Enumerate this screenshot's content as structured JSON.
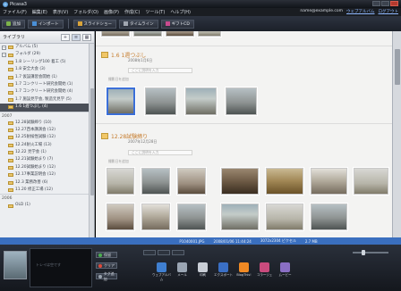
{
  "window": {
    "title": "Picasa3"
  },
  "menu": {
    "items": [
      "ファイル(F)",
      "編集(E)",
      "表示(V)",
      "フォルダ(O)",
      "画像(P)",
      "作成(C)",
      "ツール(T)",
      "ヘルプ(H)"
    ],
    "account": "name@example.com",
    "links": [
      "ウェブアルバム",
      "ログアウト"
    ]
  },
  "toolbar": {
    "add": "追加",
    "import": "インポート",
    "slideshow": "スライドショー",
    "timeline": "タイムライン",
    "gift": "ギフトCD"
  },
  "library": {
    "label": "ライブラリ",
    "toggle_collapsed": "−",
    "view_icons": [
      "+",
      "≡",
      "▦"
    ]
  },
  "folders": {
    "top": [
      {
        "label": "アルバム (5)"
      },
      {
        "label": "フォルダ (29)"
      }
    ],
    "items": [
      {
        "label": "1.8 シーリング100 着工 (5)"
      },
      {
        "label": "1.8 安全大会 (3)"
      },
      {
        "label": "1.7 仮設講習会開始 (1)"
      },
      {
        "label": "1.7 コンクリート研究会開始 (1)"
      },
      {
        "label": "1.7 コンクリート研究会開始 (4)"
      },
      {
        "label": "1.7 施設見学会, 製造元見学 (5)"
      },
      {
        "label": "1.6 1週つぶし (4)"
      }
    ],
    "group_2007": "2007",
    "items_2007": [
      {
        "label": "12.28試験締り (10)"
      },
      {
        "label": "12.27西本講演会 (12)"
      },
      {
        "label": "12.25耐候性試験 (12)"
      },
      {
        "label": "12.24耐火工場 (13)"
      },
      {
        "label": "12.22 見学会 (1)"
      },
      {
        "label": "12.21試験始まり (7)"
      },
      {
        "label": "12.20試験始まり (12)"
      },
      {
        "label": "12.17事業説明会 (12)"
      },
      {
        "label": "12.3 業務改善 (6)"
      },
      {
        "label": "11.20 修正工場 (12)"
      }
    ],
    "group_2006": "2006",
    "items_2006": [
      {
        "label": "OLD (1)"
      }
    ]
  },
  "main": {
    "folder1": {
      "name": "1.6 1週つぶし",
      "date": "2008年1月6日",
      "desc_placeholder": "ここに説明を入力",
      "hint": "撮影日を追加"
    },
    "folder2": {
      "name": "12.28試験締り",
      "date": "2007年12月28日",
      "desc_placeholder": "ここに説明を入力",
      "hint": "撮影日を追加"
    }
  },
  "status": {
    "items": [
      "P1040001.JPG",
      "2008/01/06 11:44:24",
      "3072x2304 ピクセル",
      "2.7 MB"
    ]
  },
  "tray": {
    "preview_note": "トレイは空です",
    "hold": "保留",
    "clear": "クリア",
    "add_tag": "タグ追加",
    "shares": [
      {
        "label": "ウェブアルバム",
        "color": "#3f7fd0"
      },
      {
        "label": "メール",
        "color": "#9aa5b3"
      },
      {
        "label": "印刷",
        "color": "#c9ced6"
      },
      {
        "label": "エクスポート",
        "color": "#3a6fc4"
      },
      {
        "label": "BlogThis!",
        "color": "#f08a24"
      },
      {
        "label": "コラージュ",
        "color": "#c94b7d"
      },
      {
        "label": "ムービー",
        "color": "#8a6fc4"
      }
    ]
  }
}
